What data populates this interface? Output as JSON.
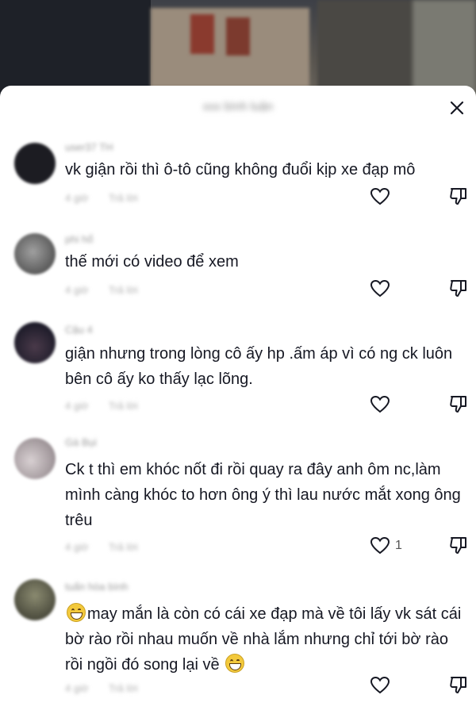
{
  "sheet": {
    "title": "xxx bình luận"
  },
  "comments": [
    {
      "username": "user37 TH",
      "text": "vk giận rồi thì ô-tô cũng không đuổi kịp xe đạp mô",
      "time": "4 giờ",
      "reply": "Trả lời",
      "like_count": "",
      "avatar_color": "#1c1c22"
    },
    {
      "username": "phi hổ",
      "text": "thế mới có video để xem",
      "time": "4 giờ",
      "reply": "Trả lời",
      "like_count": "",
      "avatar_color": "#7a7a7a"
    },
    {
      "username": "Cậu 4",
      "text": "giận nhưng trong lòng cô ấy hp .ấm áp vì có ng ck luôn bên cô ấy ko thấy lạc lõng.",
      "time": "4 giờ",
      "reply": "Trả lời",
      "like_count": "",
      "avatar_color": "#2e2a3a"
    },
    {
      "username": "Gà Bụi",
      "text": "Ck t thì em khóc nốt đi rồi quay ra đây anh ôm nc,làm mình càng khóc to hơn ông ý thì lau nước mắt xong ông trêu",
      "time": "4 giờ",
      "reply": "Trả lời",
      "like_count": "1",
      "avatar_color": "#b8b0b4"
    },
    {
      "username": "tuấn hòa bình",
      "text_before": "",
      "text": "may mắn là còn có cái xe đạp mà về tôi lấy vk sát cái bờ rào rồi nhau muốn về nhà lắm nhưng chỉ tới bờ rào rồi ngồi đó song lại về",
      "time": "4 giờ",
      "reply": "Trả lời",
      "like_count": "",
      "avatar_color": "#6a6a58"
    }
  ],
  "icons": {
    "close": "close-icon",
    "like": "heart-outline-icon",
    "dislike": "thumbs-down-icon",
    "emoji": "grinning-face-emoji"
  }
}
